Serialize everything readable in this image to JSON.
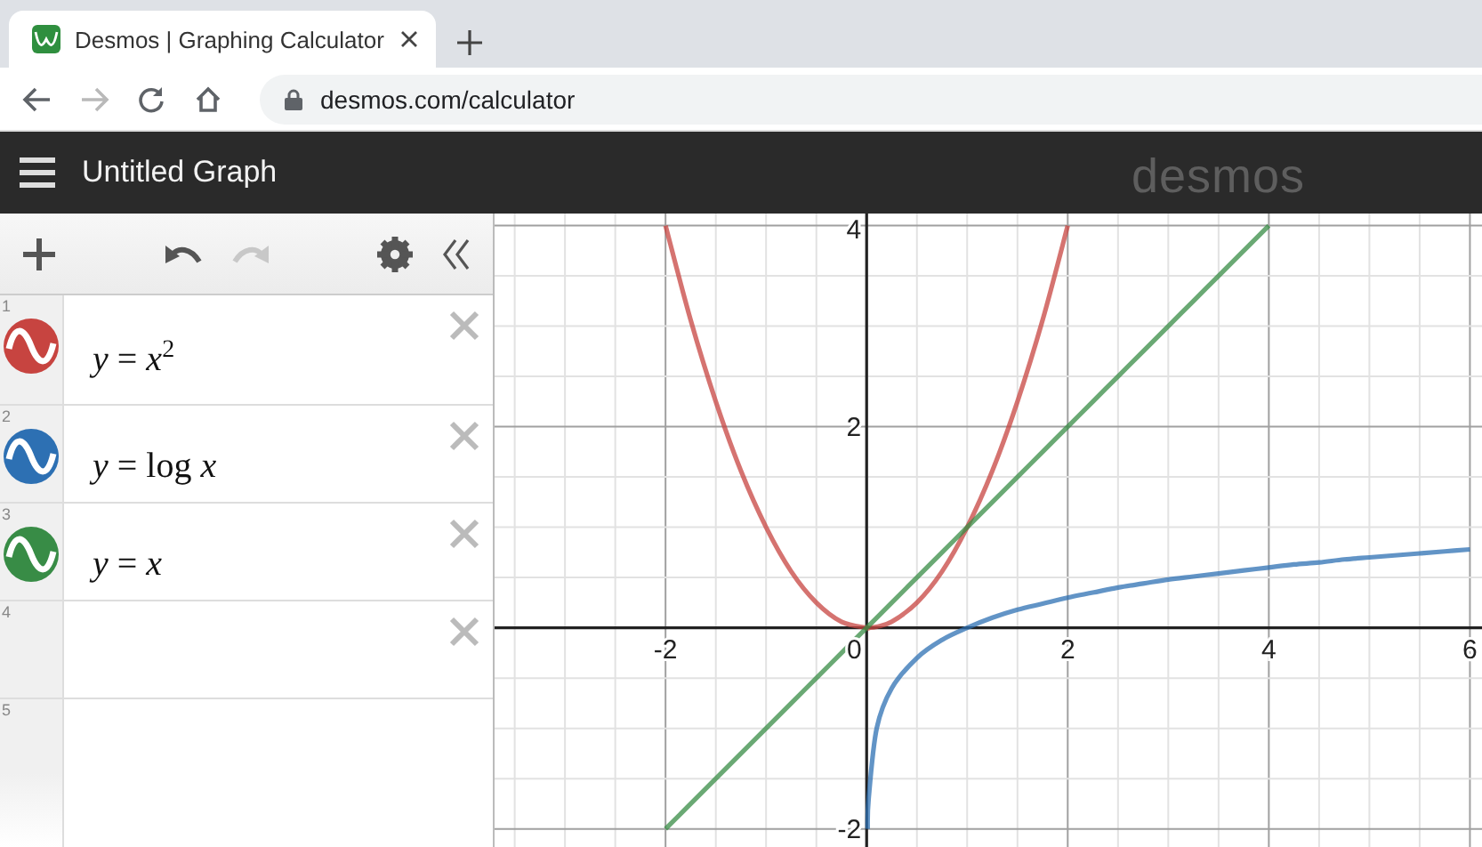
{
  "browser": {
    "tabs": [
      {
        "title": "Desmos | Graphing Calculator",
        "selected": true
      }
    ],
    "nav": [
      {
        "kind": "back",
        "disabled": false
      },
      {
        "kind": "forward",
        "disabled": true
      },
      {
        "kind": "reload",
        "disabled": false
      },
      {
        "kind": "home",
        "disabled": false
      }
    ],
    "url": "desmos.com/calculator"
  },
  "header": {
    "title": "Untitled Graph",
    "logo": "desmos"
  },
  "toolbar": [
    {
      "kind": "add",
      "disabled": false
    },
    {
      "kind": "undo",
      "disabled": false
    },
    {
      "kind": "redo",
      "disabled": true
    },
    {
      "kind": "settings",
      "disabled": false
    },
    {
      "kind": "collapse",
      "disabled": false
    }
  ],
  "expressions": [
    {
      "number": "1",
      "color": "#c74440",
      "latex": "*y* = *x*$^{2}$",
      "removable": true
    },
    {
      "number": "2",
      "color": "#2d70b3",
      "latex": "*y* = log *x*",
      "removable": true
    },
    {
      "number": "3",
      "color": "#388c46",
      "latex": "*y* = *x*",
      "removable": true
    },
    {
      "number": "4",
      "removable": true
    },
    {
      "number": "5",
      "removable": false
    }
  ],
  "graph": {
    "chart_data": {
      "type": "line",
      "x": [
        -2,
        -1.75,
        -1.5,
        -1.25,
        -1,
        -0.75,
        -0.5,
        -0.25,
        0,
        0.01,
        0.02,
        0.1,
        0.25,
        0.5,
        0.75,
        1,
        1.25,
        1.5,
        1.75,
        2,
        2.25,
        2.5,
        2.75,
        3,
        3.25,
        3.5,
        3.75,
        4,
        4.25,
        4.5,
        4.75,
        5,
        5.25,
        5.5,
        5.75,
        6
      ],
      "series": [
        {
          "color": "#c74440",
          "values": [
            4,
            3.06,
            2.25,
            1.56,
            1,
            0.56,
            0.25,
            0.06,
            0,
            0,
            0,
            0.01,
            0.06,
            0.25,
            0.56,
            1,
            1.56,
            2.25,
            3.06,
            4,
            null,
            null,
            null,
            null,
            null,
            null,
            null,
            null,
            null,
            null,
            null,
            null,
            null,
            null,
            null,
            null
          ]
        },
        {
          "color": "#2d70b3",
          "values": [
            null,
            null,
            null,
            null,
            null,
            null,
            null,
            null,
            null,
            -2,
            -1.7,
            -1,
            -0.6,
            -0.3,
            -0.12,
            0,
            0.1,
            0.18,
            0.24,
            0.3,
            0.35,
            0.4,
            0.44,
            0.48,
            0.51,
            0.54,
            0.57,
            0.6,
            0.63,
            0.65,
            0.68,
            0.7,
            0.72,
            0.74,
            0.76,
            0.78
          ]
        },
        {
          "color": "#388c46",
          "values": [
            -2,
            -1.75,
            -1.5,
            -1.25,
            -1,
            -0.75,
            -0.5,
            -0.25,
            0,
            0.01,
            0.02,
            0.1,
            0.25,
            0.5,
            0.75,
            1,
            1.25,
            1.5,
            1.75,
            2,
            2.25,
            2.5,
            2.75,
            3,
            3.25,
            3.5,
            3.75,
            4,
            null,
            null,
            null,
            null,
            null,
            null,
            null,
            null
          ]
        }
      ],
      "grid": true,
      "xlim": [
        -3.7,
        6.12
      ],
      "ylim": [
        -2.18,
        4.12
      ],
      "xticks": [
        -2,
        0,
        2,
        4,
        6
      ],
      "yticks": [
        -2,
        2,
        4
      ]
    }
  }
}
